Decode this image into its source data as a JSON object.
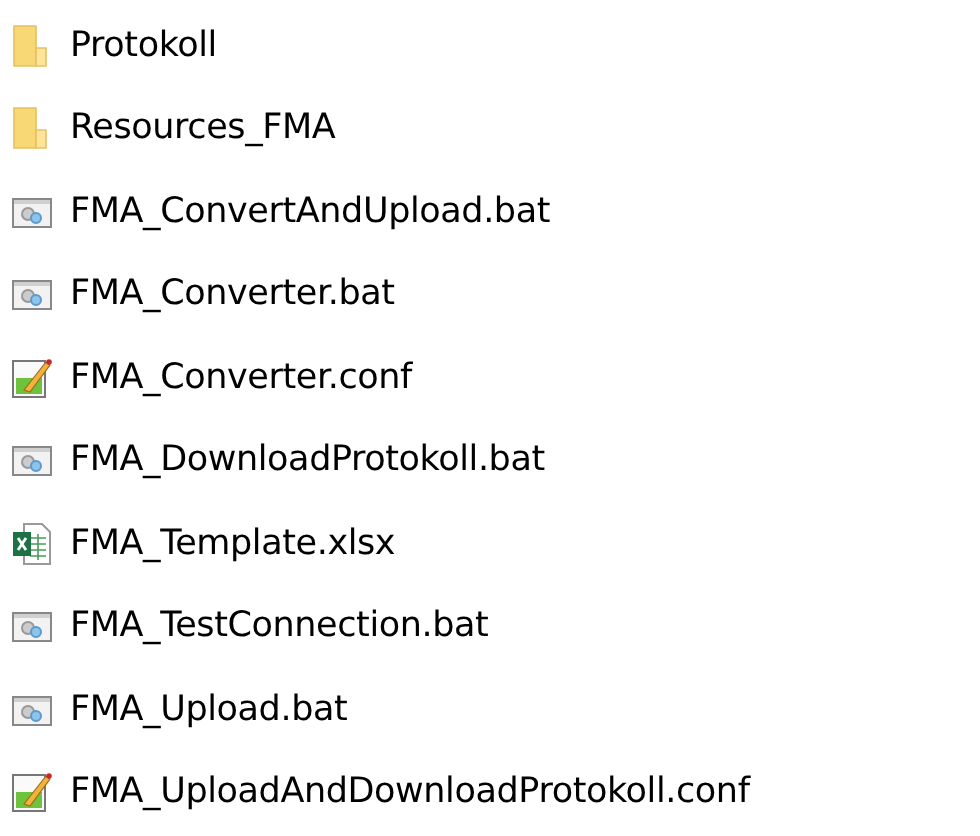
{
  "files": [
    {
      "name": "Protokoll",
      "kind": "folder"
    },
    {
      "name": "Resources_FMA",
      "kind": "folder"
    },
    {
      "name": "FMA_ConvertAndUpload.bat",
      "kind": "batch"
    },
    {
      "name": "FMA_Converter.bat",
      "kind": "batch"
    },
    {
      "name": "FMA_Converter.conf",
      "kind": "config"
    },
    {
      "name": "FMA_DownloadProtokoll.bat",
      "kind": "batch"
    },
    {
      "name": "FMA_Template.xlsx",
      "kind": "spreadsheet"
    },
    {
      "name": "FMA_TestConnection.bat",
      "kind": "batch"
    },
    {
      "name": "FMA_Upload.bat",
      "kind": "batch"
    },
    {
      "name": "FMA_UploadAndDownloadProtokoll.conf",
      "kind": "config"
    }
  ]
}
